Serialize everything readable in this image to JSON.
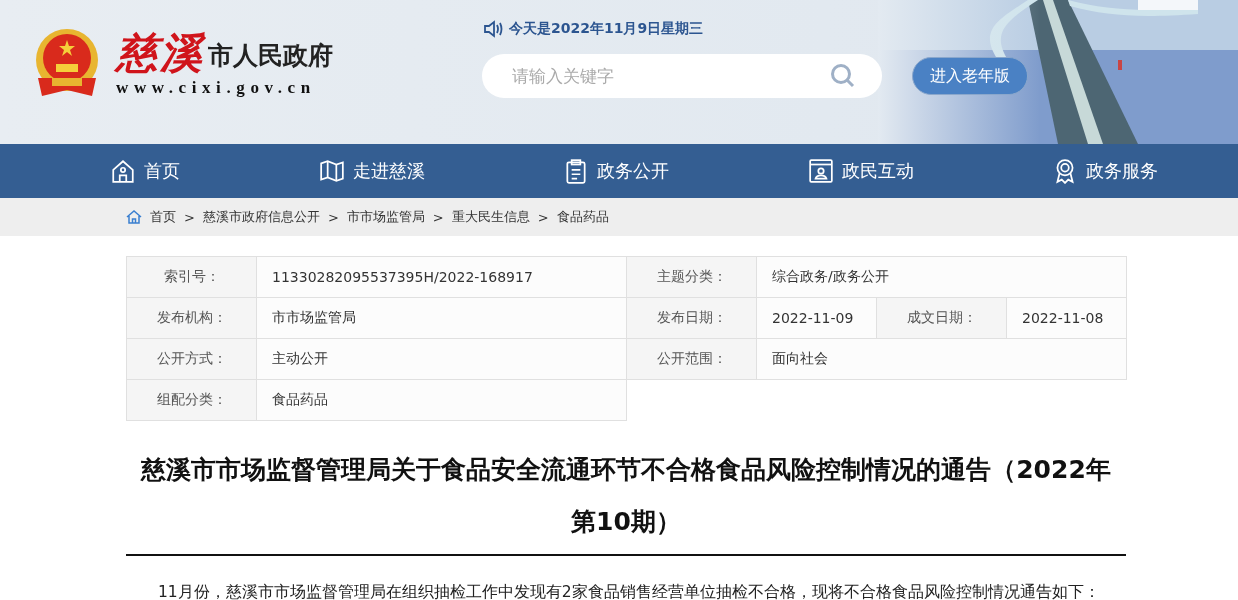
{
  "header": {
    "logo_name": "慈溪",
    "logo_suffix": "市人民政府",
    "url": "www.cixi.gov.cn",
    "date": "今天是2022年11月9日星期三",
    "search": {
      "placeholder": "请输入关键字"
    },
    "elder_button": "进入老年版"
  },
  "nav": [
    {
      "label": "首页"
    },
    {
      "label": "走进慈溪"
    },
    {
      "label": "政务公开"
    },
    {
      "label": "政民互动"
    },
    {
      "label": "政务服务"
    }
  ],
  "breadcrumb": {
    "separator": ">",
    "items": [
      "首页",
      "慈溪市政府信息公开",
      "市市场监管局",
      "重大民生信息",
      "食品药品"
    ]
  },
  "info_rows": [
    [
      {
        "label": "索引号：",
        "value": "11330282095537395H/2022-168917"
      },
      {
        "label": "主题分类：",
        "value": "综合政务/政务公开"
      }
    ],
    [
      {
        "label": "发布机构：",
        "value": "市市场监管局"
      },
      {
        "label": "发布日期：",
        "value": "2022-11-09"
      },
      {
        "label": "成文日期：",
        "value": "2022-11-08"
      }
    ],
    [
      {
        "label": "公开方式：",
        "value": "主动公开"
      },
      {
        "label": "公开范围：",
        "value": "面向社会"
      }
    ],
    [
      {
        "label": "组配分类：",
        "value": "食品药品"
      }
    ]
  ],
  "article": {
    "title": "慈溪市市场监督管理局关于食品安全流通环节不合格食品风险控制情况的通告（2022年第10期）",
    "paragraph": "11月份，慈溪市市场监督管理局在组织抽检工作中发现有2家食品销售经营单位抽检不合格，现将不合格食品风险控制情况通告如下："
  }
}
